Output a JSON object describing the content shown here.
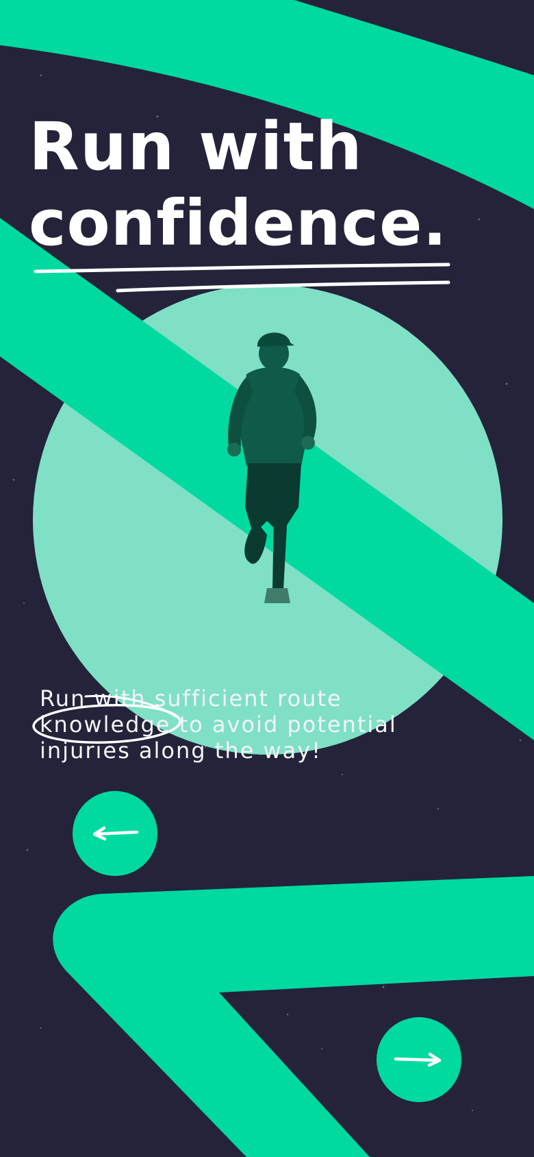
{
  "hero": {
    "title_line1": "Run with",
    "title_line2": "confidence."
  },
  "body_text": {
    "part1": "Run with sufficient route",
    "highlight": "knowledge",
    "part2": " to avoid potential",
    "part3": "injuries along the way!"
  },
  "nav": {
    "prev_icon": "arrow-left-icon",
    "next_icon": "arrow-right-icon"
  },
  "colors": {
    "background": "#24233a",
    "accent": "#00d9a0",
    "circle": "#7fe0c6",
    "text": "#ffffff"
  }
}
